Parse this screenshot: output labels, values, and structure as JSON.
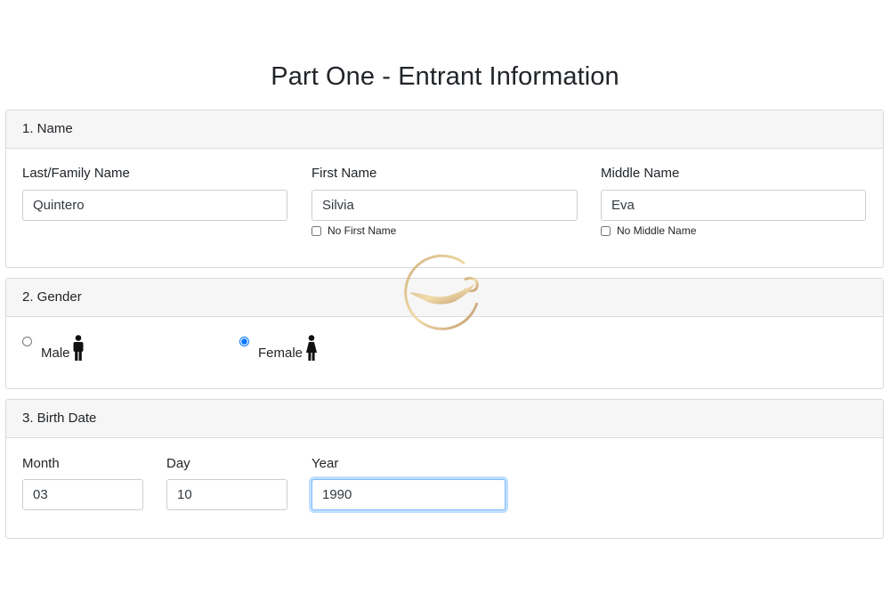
{
  "page": {
    "title": "Part One - Entrant Information"
  },
  "name_section": {
    "header": "1. Name",
    "last_name": {
      "label": "Last/Family Name",
      "value": "Quintero"
    },
    "first_name": {
      "label": "First Name",
      "value": "Silvia",
      "no_checkbox_label": "No First Name",
      "no_checked": false
    },
    "middle_name": {
      "label": "Middle Name",
      "value": "Eva",
      "no_checkbox_label": "No Middle Name",
      "no_checked": false
    }
  },
  "gender_section": {
    "header": "2. Gender",
    "male": {
      "label": "Male",
      "icon": "male-person-icon",
      "selected": false
    },
    "female": {
      "label": "Female",
      "icon": "female-person-icon",
      "selected": true
    }
  },
  "birth_section": {
    "header": "3. Birth Date",
    "month": {
      "label": "Month",
      "value": "03"
    },
    "day": {
      "label": "Day",
      "value": "10"
    },
    "year": {
      "label": "Year",
      "value": "1990",
      "focused": true
    }
  },
  "colors": {
    "focus_border": "#80bdff",
    "header_bg": "#f6f6f6",
    "watermark_gold": "#d9b56a"
  }
}
